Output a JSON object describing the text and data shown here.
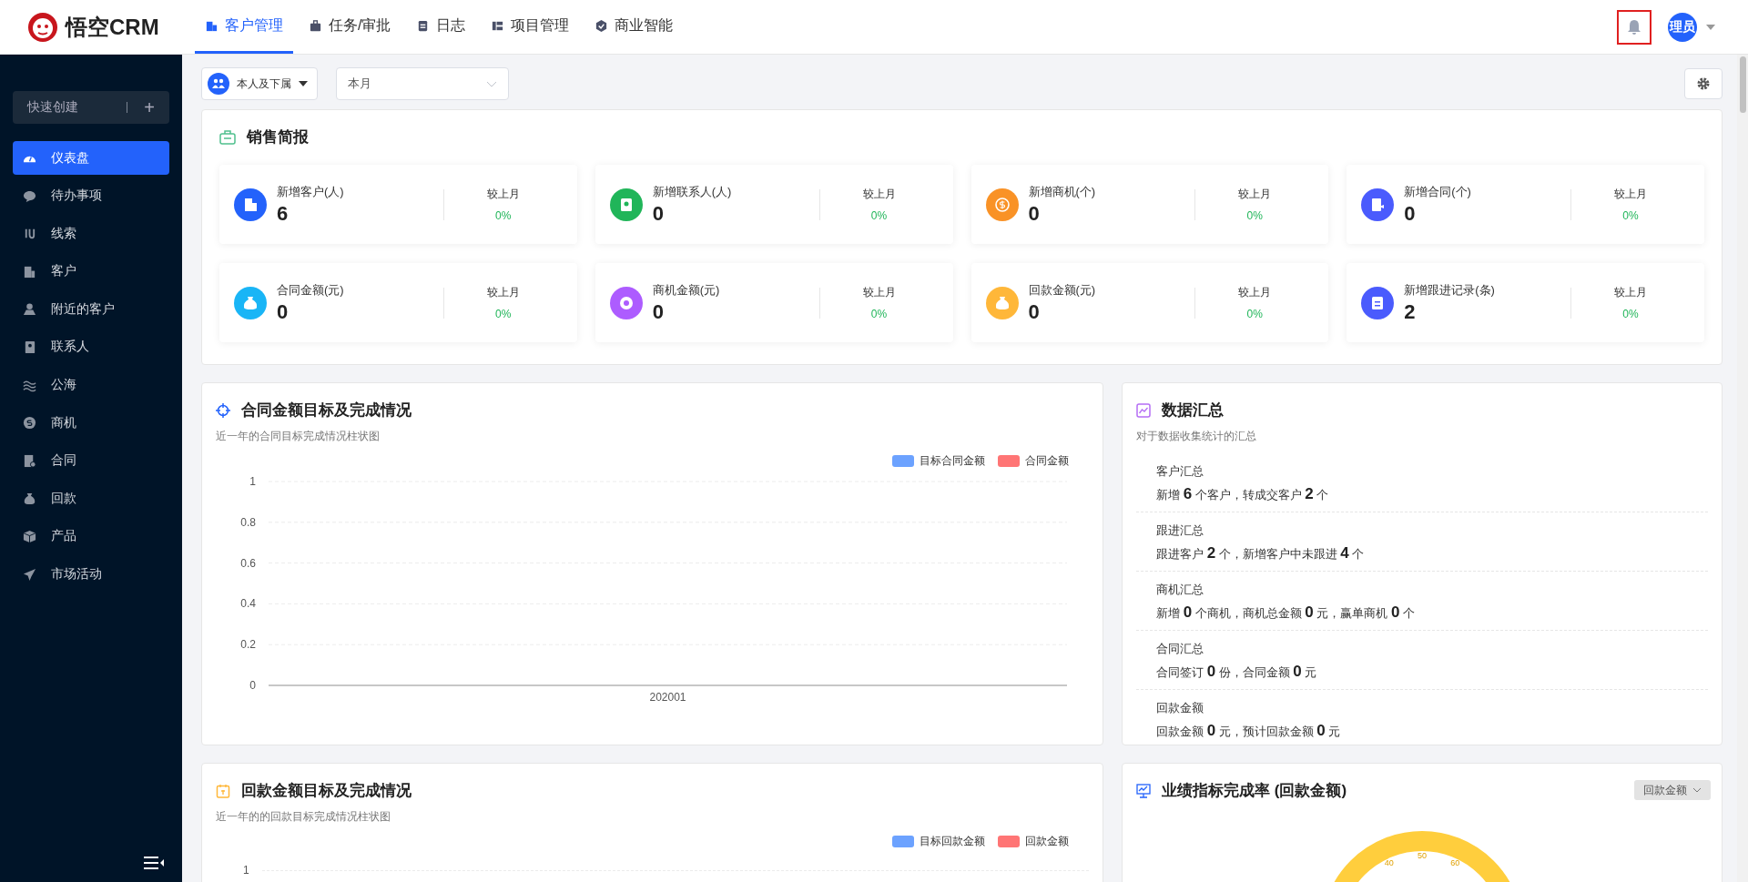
{
  "header": {
    "logo_text": "悟空CRM",
    "nav_tabs": [
      {
        "label": "客户管理",
        "selected": true
      },
      {
        "label": "任务/审批",
        "selected": false
      },
      {
        "label": "日志",
        "selected": false
      },
      {
        "label": "项目管理",
        "selected": false
      },
      {
        "label": "商业智能",
        "selected": false
      }
    ],
    "avatar": "理员"
  },
  "sidebar": {
    "quick_create": "快速创建",
    "quick_create_symbol": "+",
    "items": [
      {
        "label": "仪表盘",
        "selected": true
      },
      {
        "label": "待办事项",
        "selected": false
      },
      {
        "label": "线索",
        "selected": false
      },
      {
        "label": "客户",
        "selected": false
      },
      {
        "label": "附近的客户",
        "selected": false
      },
      {
        "label": "联系人",
        "selected": false
      },
      {
        "label": "公海",
        "selected": false
      },
      {
        "label": "商机",
        "selected": false
      },
      {
        "label": "合同",
        "selected": false
      },
      {
        "label": "回款",
        "selected": false
      },
      {
        "label": "产品",
        "selected": false
      },
      {
        "label": "市场活动",
        "selected": false
      }
    ]
  },
  "filters": {
    "scope": "本人及下属",
    "period": "本月"
  },
  "sales_report": {
    "title": "销售简报",
    "cards": [
      {
        "label": "新增客户(人)",
        "value": "6",
        "compare_label": "较上月",
        "change": "0%",
        "color": "#2362fb"
      },
      {
        "label": "新增联系人(人)",
        "value": "0",
        "compare_label": "较上月",
        "change": "0%",
        "color": "#20b559"
      },
      {
        "label": "新增商机(个)",
        "value": "0",
        "compare_label": "较上月",
        "change": "0%",
        "color": "#f99226"
      },
      {
        "label": "新增合同(个)",
        "value": "0",
        "compare_label": "较上月",
        "change": "0%",
        "color": "#4a5bfd"
      },
      {
        "label": "合同金额(元)",
        "value": "0",
        "compare_label": "较上月",
        "change": "0%",
        "color": "#19b5f6"
      },
      {
        "label": "商机金额(元)",
        "value": "0",
        "compare_label": "较上月",
        "change": "0%",
        "color": "#ad5cff"
      },
      {
        "label": "回款金额(元)",
        "value": "0",
        "compare_label": "较上月",
        "change": "0%",
        "color": "#ffb739"
      },
      {
        "label": "新增跟进记录(条)",
        "value": "2",
        "compare_label": "较上月",
        "change": "0%",
        "color": "#4a5bfd"
      }
    ]
  },
  "contract_chart": {
    "title": "合同金额目标及完成情况",
    "subtitle": "近一年的合同目标完成情况柱状图",
    "chart_data": {
      "type": "bar",
      "categories": [
        "202001"
      ],
      "series": [
        {
          "name": "目标合同金额",
          "color": "#6ca2ff",
          "values": [
            0
          ]
        },
        {
          "name": "合同金额",
          "color": "#ff7575",
          "values": [
            0
          ]
        }
      ],
      "ylim": [
        0,
        1
      ],
      "yticks": [
        0,
        0.2,
        0.4,
        0.6,
        0.8,
        1
      ],
      "grid": true
    }
  },
  "data_summary": {
    "title": "数据汇总",
    "subtitle": "对于数据收集统计的汇总",
    "sections": [
      {
        "heading": "客户汇总",
        "text": "新增 **6** 个客户，转成交客户 **2** 个"
      },
      {
        "heading": "跟进汇总",
        "text": "跟进客户 **2** 个，新增客户中未跟进 **4** 个"
      },
      {
        "heading": "商机汇总",
        "text": "新增 **0** 个商机，商机总金额 **0** 元，赢单商机 **0** 个"
      },
      {
        "heading": "合同汇总",
        "text": "合同签订 **0** 份，合同金额 **0** 元"
      },
      {
        "heading": "回款金额",
        "text": "回款金额 **0** 元，预计回款金额 **0** 元"
      }
    ]
  },
  "payment_chart": {
    "title": "回款金额目标及完成情况",
    "subtitle": "近一年的的回款目标完成情况柱状图",
    "legend": [
      {
        "name": "目标回款金额",
        "color": "#6ca2ff"
      },
      {
        "name": "回款金额",
        "color": "#ff7575"
      }
    ],
    "top_tick": "1"
  },
  "performance": {
    "title": "业绩指标完成率 (回款金额)",
    "dropdown": "回款金额",
    "gauge_ticks": [
      "40",
      "50",
      "60"
    ]
  }
}
